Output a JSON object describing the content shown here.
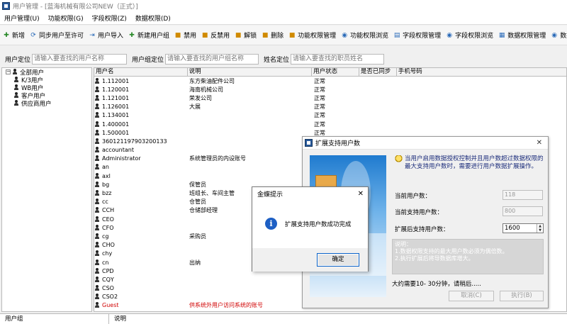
{
  "window": {
    "title": "用户管理 - [蓝海机械有限公司NEW（正式）]"
  },
  "menu": [
    "用户管理(U)",
    "功能权限(G)",
    "字段权限(Z)",
    "数据权限(D)"
  ],
  "toolbar": [
    {
      "label": "新增",
      "icon": "plus-icon",
      "color": "#2a8a2a"
    },
    {
      "label": "同步用户至许可",
      "icon": "sync-icon",
      "color": "#2a6ab8"
    },
    {
      "label": "用户导入",
      "icon": "import-icon",
      "color": "#2a6ab8"
    },
    {
      "label": "新建用户组",
      "icon": "group-add-icon",
      "color": "#2a8a2a"
    },
    {
      "label": "禁用",
      "icon": "disable-icon",
      "color": "#d08a00"
    },
    {
      "label": "反禁用",
      "icon": "enable-icon",
      "color": "#d08a00"
    },
    {
      "label": "解锁",
      "icon": "unlock-icon",
      "color": "#d08a00"
    },
    {
      "label": "删除",
      "icon": "delete-icon",
      "color": "#d08a00"
    },
    {
      "label": "功能权限管理",
      "icon": "permission-icon",
      "color": "#d08a00"
    },
    {
      "label": "功能权限浏览",
      "icon": "browse-icon",
      "color": "#2a6ab8"
    },
    {
      "label": "字段权限管理",
      "icon": "field-icon",
      "color": "#2a6ab8"
    },
    {
      "label": "字段权限浏览",
      "icon": "browse-icon",
      "color": "#2a6ab8"
    },
    {
      "label": "数据权限管理",
      "icon": "data-icon",
      "color": "#2a6ab8"
    },
    {
      "label": "数据",
      "icon": "browse-icon",
      "color": "#2a6ab8"
    }
  ],
  "filters": {
    "user_label": "用户定位",
    "user_placeholder": "请输入要查找的用户名称",
    "group_label": "用户组定位",
    "group_placeholder": "请输入要查找的用户组名称",
    "employee_label": "姓名定位",
    "employee_placeholder": "请输入要查找的职员姓名"
  },
  "tree": {
    "root": "全部用户",
    "children": [
      "K/3用户",
      "WB用户",
      "客户用户",
      "供应商用户"
    ]
  },
  "grid": {
    "headers": [
      "用户名",
      "说明",
      "用户状态",
      "是否已同步",
      "手机号码"
    ],
    "rows": [
      {
        "name": "1.112001",
        "desc": "东方柴油配件公司",
        "status": "正常"
      },
      {
        "name": "1.120001",
        "desc": "海南机械公司",
        "status": "正常"
      },
      {
        "name": "1.121001",
        "desc": "荣发公司",
        "status": "正常"
      },
      {
        "name": "1.126001",
        "desc": "大展",
        "status": "正常"
      },
      {
        "name": "1.134001",
        "desc": "",
        "status": "正常"
      },
      {
        "name": "1.400001",
        "desc": "",
        "status": "正常"
      },
      {
        "name": "1.500001",
        "desc": "",
        "status": "正常"
      },
      {
        "name": "360121197903200133",
        "desc": "",
        "status": ""
      },
      {
        "name": "accountant",
        "desc": "",
        "status": ""
      },
      {
        "name": "Administrator",
        "desc": "系统管理员的内设账号",
        "status": ""
      },
      {
        "name": "an",
        "desc": "",
        "status": ""
      },
      {
        "name": "axl",
        "desc": "",
        "status": ""
      },
      {
        "name": "bg",
        "desc": "保管员",
        "status": ""
      },
      {
        "name": "bzz",
        "desc": "班组长、车间主管",
        "status": ""
      },
      {
        "name": "cc",
        "desc": "仓管员",
        "status": ""
      },
      {
        "name": "CCH",
        "desc": "仓储部经理",
        "status": ""
      },
      {
        "name": "CEO",
        "desc": "",
        "status": ""
      },
      {
        "name": "CFO",
        "desc": "",
        "status": ""
      },
      {
        "name": "cg",
        "desc": "采购员",
        "status": ""
      },
      {
        "name": "CHO",
        "desc": "",
        "status": ""
      },
      {
        "name": "chy",
        "desc": "",
        "status": ""
      },
      {
        "name": "cn",
        "desc": "出纳",
        "status": ""
      },
      {
        "name": "CPD",
        "desc": "",
        "status": ""
      },
      {
        "name": "CQY",
        "desc": "",
        "status": ""
      },
      {
        "name": "CSO",
        "desc": "",
        "status": ""
      },
      {
        "name": "CSO2",
        "desc": "",
        "status": ""
      },
      {
        "name": "Guest",
        "desc": "供系统外用户访问系统的账号",
        "status": "",
        "red": true
      },
      {
        "name": "",
        "desc": "",
        "status": "正常"
      }
    ]
  },
  "bottom_headers": [
    "用户组",
    "说明"
  ],
  "expand_dialog": {
    "title": "扩展支持用户数",
    "description": "当用户启用数据授权控制并且用户数超过数据权限的最大支持用户数时，需要进行用户数据扩展操作。",
    "current_users_label": "当前用户数：",
    "current_users": "118",
    "current_support_label": "当前支持用户数：",
    "current_support": "800",
    "after_label": "扩展后支持用户数：",
    "after_value": "1600",
    "notes": [
      "说明：",
      "1.数据权限支持的最大用户数必须为偶倍数。",
      "2.执行扩展后将导数据库增大。"
    ],
    "wait_text": "大约需要10- 30分钟，请稍后.....",
    "cancel": "取消(C)",
    "run": "执行(B)"
  },
  "message_box": {
    "title": "金蝶提示",
    "message": "扩展支持用户数成功完成",
    "ok": "确定"
  }
}
